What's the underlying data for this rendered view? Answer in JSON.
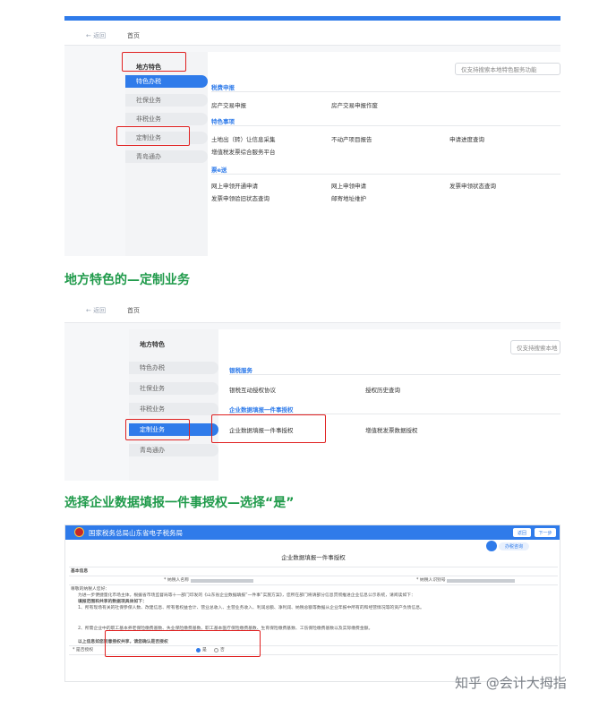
{
  "shot1": {
    "back": "← 返回",
    "home": "首页",
    "sidebar_title": "地方特色",
    "sidebar_items": [
      "特色办税",
      "社保业务",
      "非税业务",
      "定制业务",
      "青岛通办"
    ],
    "search_placeholder": "仅支持搜索本地特色服务功能",
    "sections": [
      {
        "title": "税费申报",
        "links": [
          "房产交易申报",
          "房产交易申报作废"
        ]
      },
      {
        "title": "特色事项",
        "links": [
          "土地出（转）让信息采集",
          "不动产项目报告",
          "申请进度查询",
          "增值税发票综合服务平台"
        ]
      },
      {
        "title": "票e送",
        "links": [
          "网上申领开通申请",
          "网上申领申请",
          "发票申领状态查询",
          "发票申领验旧状态查询",
          "邮寄地址维护"
        ]
      }
    ]
  },
  "caption1": "地方特色的—定制业务",
  "shot2": {
    "back": "← 返回",
    "home": "首页",
    "sidebar_title": "地方特色",
    "sidebar_items": [
      "特色办税",
      "社保业务",
      "非税业务",
      "定制业务",
      "青岛通办"
    ],
    "search_placeholder": "仅支持搜索本地",
    "sections": [
      {
        "title": "银税服务",
        "links": [
          "银税互动授权协议",
          "授权历史查询"
        ]
      },
      {
        "title": "企业数据填报一件事授权",
        "links": [
          "企业数据填报一件事授权",
          "增值税发票数据授权"
        ]
      }
    ]
  },
  "caption2": "选择企业数据填报一件事授权—选择“是”",
  "shot3": {
    "header_title": "国家税务总局山东省电子税务局",
    "btn_prev": "返回",
    "btn_next": "下一步",
    "helper": "办税咨询",
    "form_title": "企业数据填报一件事授权",
    "basic_info": "基本信息",
    "taxpayer_name_label": "* 纳税人名称",
    "taxpayer_id_label": "* 纳税人识别号",
    "para_salutation": "尊敬的纳税人您好：",
    "para_intro": "为进一步便捷量化市场主体，根据省市场监督局等十一部门印发的《山东省企业数据填报“一件事”实施方案》，您所在部门将请部分信息贯彻推进企业信息公示系统，请阅读如下：",
    "para_bold": "填报范围和共享的数据项具体如下：",
    "para_1": "1、所有现场有关的社保参保人数、改建信息、所有者权益合计、营业总收入、主营业务收入、利润总额、净利润、纳税总额等数据从企业年报中所有的和经营情况等的资产负债信息。",
    "para_2": "2、所需企业中的职工基本养老保险缴费基数、失业保险缴费基数、职工基本医疗保险缴费基数、生育保险缴费基数、工伤保险缴费基数以及实际缴费金额。",
    "para_confirm": "以上信息如您同意授权共享，请您确认是否授权",
    "authorize_label": "* 是否授权",
    "option_yes": "是",
    "option_no": "否"
  },
  "watermark": "知乎 @会计大拇指"
}
